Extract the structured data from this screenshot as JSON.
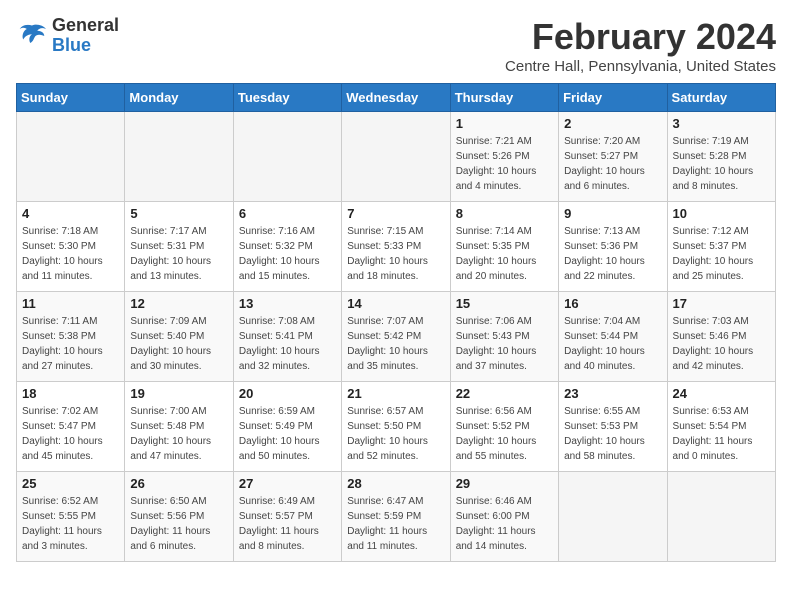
{
  "logo": {
    "general": "General",
    "blue": "Blue"
  },
  "title": "February 2024",
  "subtitle": "Centre Hall, Pennsylvania, United States",
  "headers": [
    "Sunday",
    "Monday",
    "Tuesday",
    "Wednesday",
    "Thursday",
    "Friday",
    "Saturday"
  ],
  "weeks": [
    [
      {
        "day": "",
        "sunrise": "",
        "sunset": "",
        "daylight": ""
      },
      {
        "day": "",
        "sunrise": "",
        "sunset": "",
        "daylight": ""
      },
      {
        "day": "",
        "sunrise": "",
        "sunset": "",
        "daylight": ""
      },
      {
        "day": "",
        "sunrise": "",
        "sunset": "",
        "daylight": ""
      },
      {
        "day": "1",
        "sunrise": "Sunrise: 7:21 AM",
        "sunset": "Sunset: 5:26 PM",
        "daylight": "Daylight: 10 hours and 4 minutes."
      },
      {
        "day": "2",
        "sunrise": "Sunrise: 7:20 AM",
        "sunset": "Sunset: 5:27 PM",
        "daylight": "Daylight: 10 hours and 6 minutes."
      },
      {
        "day": "3",
        "sunrise": "Sunrise: 7:19 AM",
        "sunset": "Sunset: 5:28 PM",
        "daylight": "Daylight: 10 hours and 8 minutes."
      }
    ],
    [
      {
        "day": "4",
        "sunrise": "Sunrise: 7:18 AM",
        "sunset": "Sunset: 5:30 PM",
        "daylight": "Daylight: 10 hours and 11 minutes."
      },
      {
        "day": "5",
        "sunrise": "Sunrise: 7:17 AM",
        "sunset": "Sunset: 5:31 PM",
        "daylight": "Daylight: 10 hours and 13 minutes."
      },
      {
        "day": "6",
        "sunrise": "Sunrise: 7:16 AM",
        "sunset": "Sunset: 5:32 PM",
        "daylight": "Daylight: 10 hours and 15 minutes."
      },
      {
        "day": "7",
        "sunrise": "Sunrise: 7:15 AM",
        "sunset": "Sunset: 5:33 PM",
        "daylight": "Daylight: 10 hours and 18 minutes."
      },
      {
        "day": "8",
        "sunrise": "Sunrise: 7:14 AM",
        "sunset": "Sunset: 5:35 PM",
        "daylight": "Daylight: 10 hours and 20 minutes."
      },
      {
        "day": "9",
        "sunrise": "Sunrise: 7:13 AM",
        "sunset": "Sunset: 5:36 PM",
        "daylight": "Daylight: 10 hours and 22 minutes."
      },
      {
        "day": "10",
        "sunrise": "Sunrise: 7:12 AM",
        "sunset": "Sunset: 5:37 PM",
        "daylight": "Daylight: 10 hours and 25 minutes."
      }
    ],
    [
      {
        "day": "11",
        "sunrise": "Sunrise: 7:11 AM",
        "sunset": "Sunset: 5:38 PM",
        "daylight": "Daylight: 10 hours and 27 minutes."
      },
      {
        "day": "12",
        "sunrise": "Sunrise: 7:09 AM",
        "sunset": "Sunset: 5:40 PM",
        "daylight": "Daylight: 10 hours and 30 minutes."
      },
      {
        "day": "13",
        "sunrise": "Sunrise: 7:08 AM",
        "sunset": "Sunset: 5:41 PM",
        "daylight": "Daylight: 10 hours and 32 minutes."
      },
      {
        "day": "14",
        "sunrise": "Sunrise: 7:07 AM",
        "sunset": "Sunset: 5:42 PM",
        "daylight": "Daylight: 10 hours and 35 minutes."
      },
      {
        "day": "15",
        "sunrise": "Sunrise: 7:06 AM",
        "sunset": "Sunset: 5:43 PM",
        "daylight": "Daylight: 10 hours and 37 minutes."
      },
      {
        "day": "16",
        "sunrise": "Sunrise: 7:04 AM",
        "sunset": "Sunset: 5:44 PM",
        "daylight": "Daylight: 10 hours and 40 minutes."
      },
      {
        "day": "17",
        "sunrise": "Sunrise: 7:03 AM",
        "sunset": "Sunset: 5:46 PM",
        "daylight": "Daylight: 10 hours and 42 minutes."
      }
    ],
    [
      {
        "day": "18",
        "sunrise": "Sunrise: 7:02 AM",
        "sunset": "Sunset: 5:47 PM",
        "daylight": "Daylight: 10 hours and 45 minutes."
      },
      {
        "day": "19",
        "sunrise": "Sunrise: 7:00 AM",
        "sunset": "Sunset: 5:48 PM",
        "daylight": "Daylight: 10 hours and 47 minutes."
      },
      {
        "day": "20",
        "sunrise": "Sunrise: 6:59 AM",
        "sunset": "Sunset: 5:49 PM",
        "daylight": "Daylight: 10 hours and 50 minutes."
      },
      {
        "day": "21",
        "sunrise": "Sunrise: 6:57 AM",
        "sunset": "Sunset: 5:50 PM",
        "daylight": "Daylight: 10 hours and 52 minutes."
      },
      {
        "day": "22",
        "sunrise": "Sunrise: 6:56 AM",
        "sunset": "Sunset: 5:52 PM",
        "daylight": "Daylight: 10 hours and 55 minutes."
      },
      {
        "day": "23",
        "sunrise": "Sunrise: 6:55 AM",
        "sunset": "Sunset: 5:53 PM",
        "daylight": "Daylight: 10 hours and 58 minutes."
      },
      {
        "day": "24",
        "sunrise": "Sunrise: 6:53 AM",
        "sunset": "Sunset: 5:54 PM",
        "daylight": "Daylight: 11 hours and 0 minutes."
      }
    ],
    [
      {
        "day": "25",
        "sunrise": "Sunrise: 6:52 AM",
        "sunset": "Sunset: 5:55 PM",
        "daylight": "Daylight: 11 hours and 3 minutes."
      },
      {
        "day": "26",
        "sunrise": "Sunrise: 6:50 AM",
        "sunset": "Sunset: 5:56 PM",
        "daylight": "Daylight: 11 hours and 6 minutes."
      },
      {
        "day": "27",
        "sunrise": "Sunrise: 6:49 AM",
        "sunset": "Sunset: 5:57 PM",
        "daylight": "Daylight: 11 hours and 8 minutes."
      },
      {
        "day": "28",
        "sunrise": "Sunrise: 6:47 AM",
        "sunset": "Sunset: 5:59 PM",
        "daylight": "Daylight: 11 hours and 11 minutes."
      },
      {
        "day": "29",
        "sunrise": "Sunrise: 6:46 AM",
        "sunset": "Sunset: 6:00 PM",
        "daylight": "Daylight: 11 hours and 14 minutes."
      },
      {
        "day": "",
        "sunrise": "",
        "sunset": "",
        "daylight": ""
      },
      {
        "day": "",
        "sunrise": "",
        "sunset": "",
        "daylight": ""
      }
    ]
  ]
}
